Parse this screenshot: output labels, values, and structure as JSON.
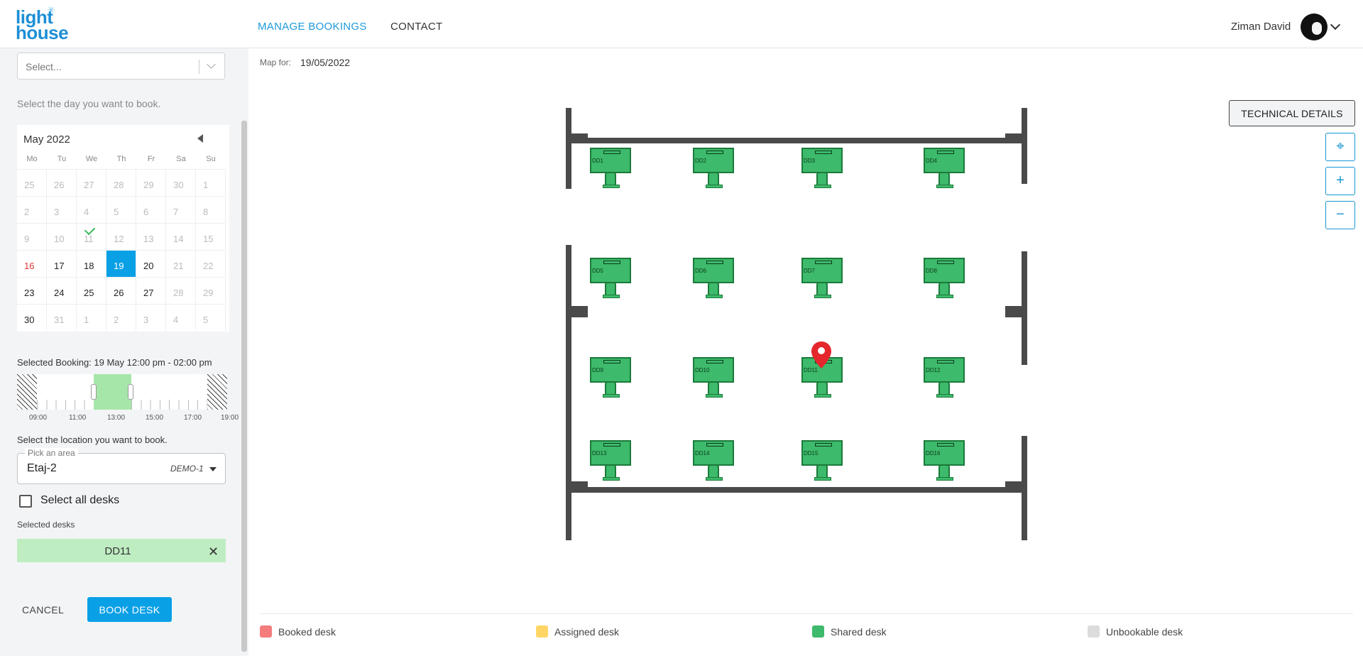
{
  "header": {
    "logo_line1": "light",
    "logo_line2": "house",
    "nav": [
      {
        "label": "MANAGE BOOKINGS",
        "active": true
      },
      {
        "label": "CONTACT",
        "active": false
      }
    ],
    "user_name": "Ziman David"
  },
  "sidebar": {
    "select_placeholder": "Select...",
    "day_hint": "Select the day you want to book.",
    "calendar": {
      "month": "May 2022",
      "dows": [
        "Mo",
        "Tu",
        "We",
        "Th",
        "Fr",
        "Sa",
        "Su"
      ],
      "days": [
        {
          "d": "25",
          "s": "out"
        },
        {
          "d": "26",
          "s": "out"
        },
        {
          "d": "27",
          "s": "out"
        },
        {
          "d": "28",
          "s": "out"
        },
        {
          "d": "29",
          "s": "out"
        },
        {
          "d": "30",
          "s": "out"
        },
        {
          "d": "1",
          "s": "out"
        },
        {
          "d": "2",
          "s": "out"
        },
        {
          "d": "3",
          "s": "out"
        },
        {
          "d": "4",
          "s": "out"
        },
        {
          "d": "5",
          "s": "out"
        },
        {
          "d": "6",
          "s": "out"
        },
        {
          "d": "7",
          "s": "out"
        },
        {
          "d": "8",
          "s": "out"
        },
        {
          "d": "9",
          "s": "out"
        },
        {
          "d": "10",
          "s": "out"
        },
        {
          "d": "11",
          "s": "out",
          "check": true
        },
        {
          "d": "12",
          "s": "out"
        },
        {
          "d": "13",
          "s": "out"
        },
        {
          "d": "14",
          "s": "out"
        },
        {
          "d": "15",
          "s": "out"
        },
        {
          "d": "16",
          "s": "red"
        },
        {
          "d": "17",
          "s": ""
        },
        {
          "d": "18",
          "s": ""
        },
        {
          "d": "19",
          "s": "sel"
        },
        {
          "d": "20",
          "s": ""
        },
        {
          "d": "21",
          "s": "out"
        },
        {
          "d": "22",
          "s": "out"
        },
        {
          "d": "23",
          "s": ""
        },
        {
          "d": "24",
          "s": ""
        },
        {
          "d": "25",
          "s": ""
        },
        {
          "d": "26",
          "s": ""
        },
        {
          "d": "27",
          "s": ""
        },
        {
          "d": "28",
          "s": "out"
        },
        {
          "d": "29",
          "s": "out"
        },
        {
          "d": "30",
          "s": ""
        },
        {
          "d": "31",
          "s": "out"
        },
        {
          "d": "1",
          "s": "out"
        },
        {
          "d": "2",
          "s": "out"
        },
        {
          "d": "3",
          "s": "out"
        },
        {
          "d": "4",
          "s": "out"
        },
        {
          "d": "5",
          "s": "out"
        }
      ]
    },
    "selected_booking": "Selected Booking: 19 May 12:00 pm - 02:00 pm",
    "timeline_labels": [
      "09:00",
      "11:00",
      "13:00",
      "15:00",
      "17:00",
      "19:00"
    ],
    "location_hint": "Select the location you want to book.",
    "area_legend": "Pick an area",
    "area_value": "Etaj-2",
    "area_code": "DEMO-1",
    "select_all_label": "Select all desks",
    "selected_desks_label": "Selected desks",
    "selected_desk": "DD11",
    "cancel_label": "CANCEL",
    "book_label": "BOOK DESK"
  },
  "main": {
    "map_for_label": "Map for:",
    "map_for_date": "19/05/2022",
    "technical_details_label": "TECHNICAL DETAILS",
    "desks": [
      "DD1",
      "DD2",
      "DD3",
      "DD4",
      "DD5",
      "DD6",
      "DD7",
      "DD8",
      "DD9",
      "DD10",
      "DD11",
      "DD12",
      "DD13",
      "DD14",
      "DD15",
      "DD16"
    ],
    "pinned_desk": "DD11"
  },
  "legend": [
    {
      "label": "Booked desk",
      "color": "#f47c7c"
    },
    {
      "label": "Assigned desk",
      "color": "#ffd666"
    },
    {
      "label": "Shared desk",
      "color": "#3dba6b"
    },
    {
      "label": "Unbookable desk",
      "color": "#dcdcdc"
    }
  ],
  "colors": {
    "accent": "#0aa0e6",
    "desk_shared": "#3dba6b",
    "pin": "#e5262d"
  }
}
